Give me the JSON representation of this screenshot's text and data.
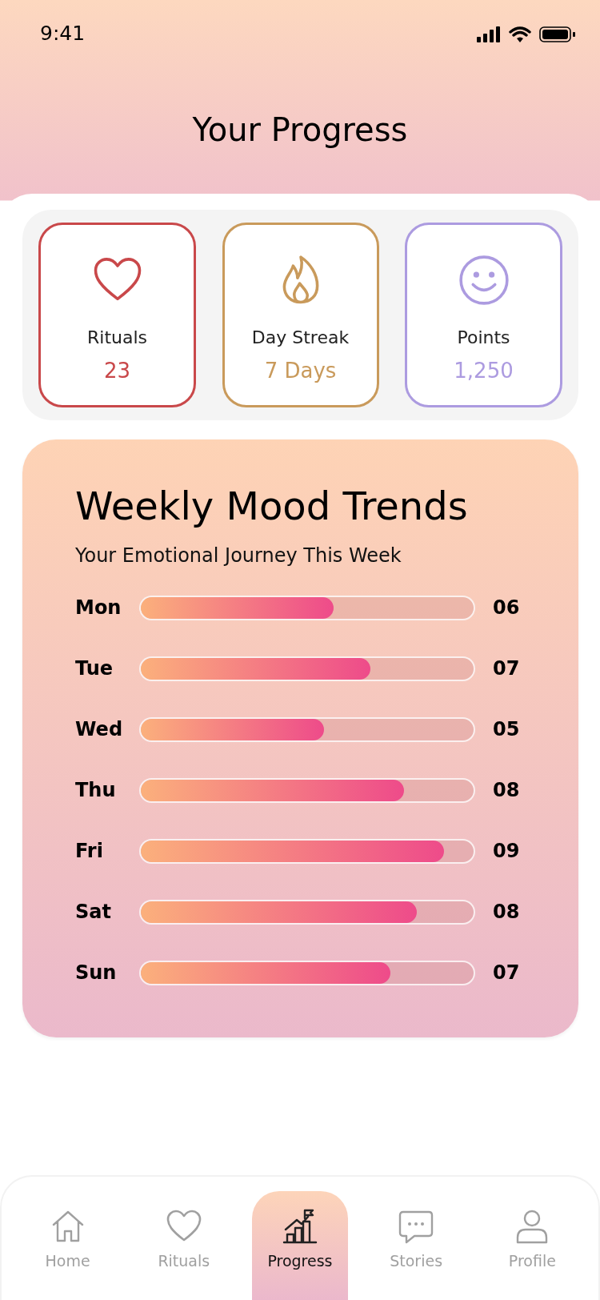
{
  "status_bar": {
    "time": "9:41"
  },
  "title": "Your Progress",
  "stats": [
    {
      "kind": "heart",
      "label": "Rituals",
      "value": "23",
      "color": "#c9484a"
    },
    {
      "kind": "flame",
      "label": "Day Streak",
      "value": "7 Days",
      "color": "#c99a5b"
    },
    {
      "kind": "smile",
      "label": "Points",
      "value": "1,250",
      "color": "#ac9be0"
    }
  ],
  "mood": {
    "title": "Weekly Mood Trends",
    "subtitle": "Your Emotional Journey This Week",
    "days": [
      {
        "day": "Mon",
        "level": 0.58,
        "reading": "06"
      },
      {
        "day": "Tue",
        "level": 0.69,
        "reading": "07"
      },
      {
        "day": "Wed",
        "level": 0.55,
        "reading": "05"
      },
      {
        "day": "Thu",
        "level": 0.79,
        "reading": "08"
      },
      {
        "day": "Fri",
        "level": 0.91,
        "reading": "09"
      },
      {
        "day": "Sat",
        "level": 0.83,
        "reading": "08"
      },
      {
        "day": "Sun",
        "level": 0.75,
        "reading": "07"
      }
    ]
  },
  "nav": [
    {
      "kind": "home",
      "label": "Home",
      "selected": false
    },
    {
      "kind": "heart",
      "label": "Rituals",
      "selected": false
    },
    {
      "kind": "progress",
      "label": "Progress",
      "selected": true
    },
    {
      "kind": "chat",
      "label": "Stories",
      "selected": false
    },
    {
      "kind": "person",
      "label": "Profile",
      "selected": false
    }
  ]
}
